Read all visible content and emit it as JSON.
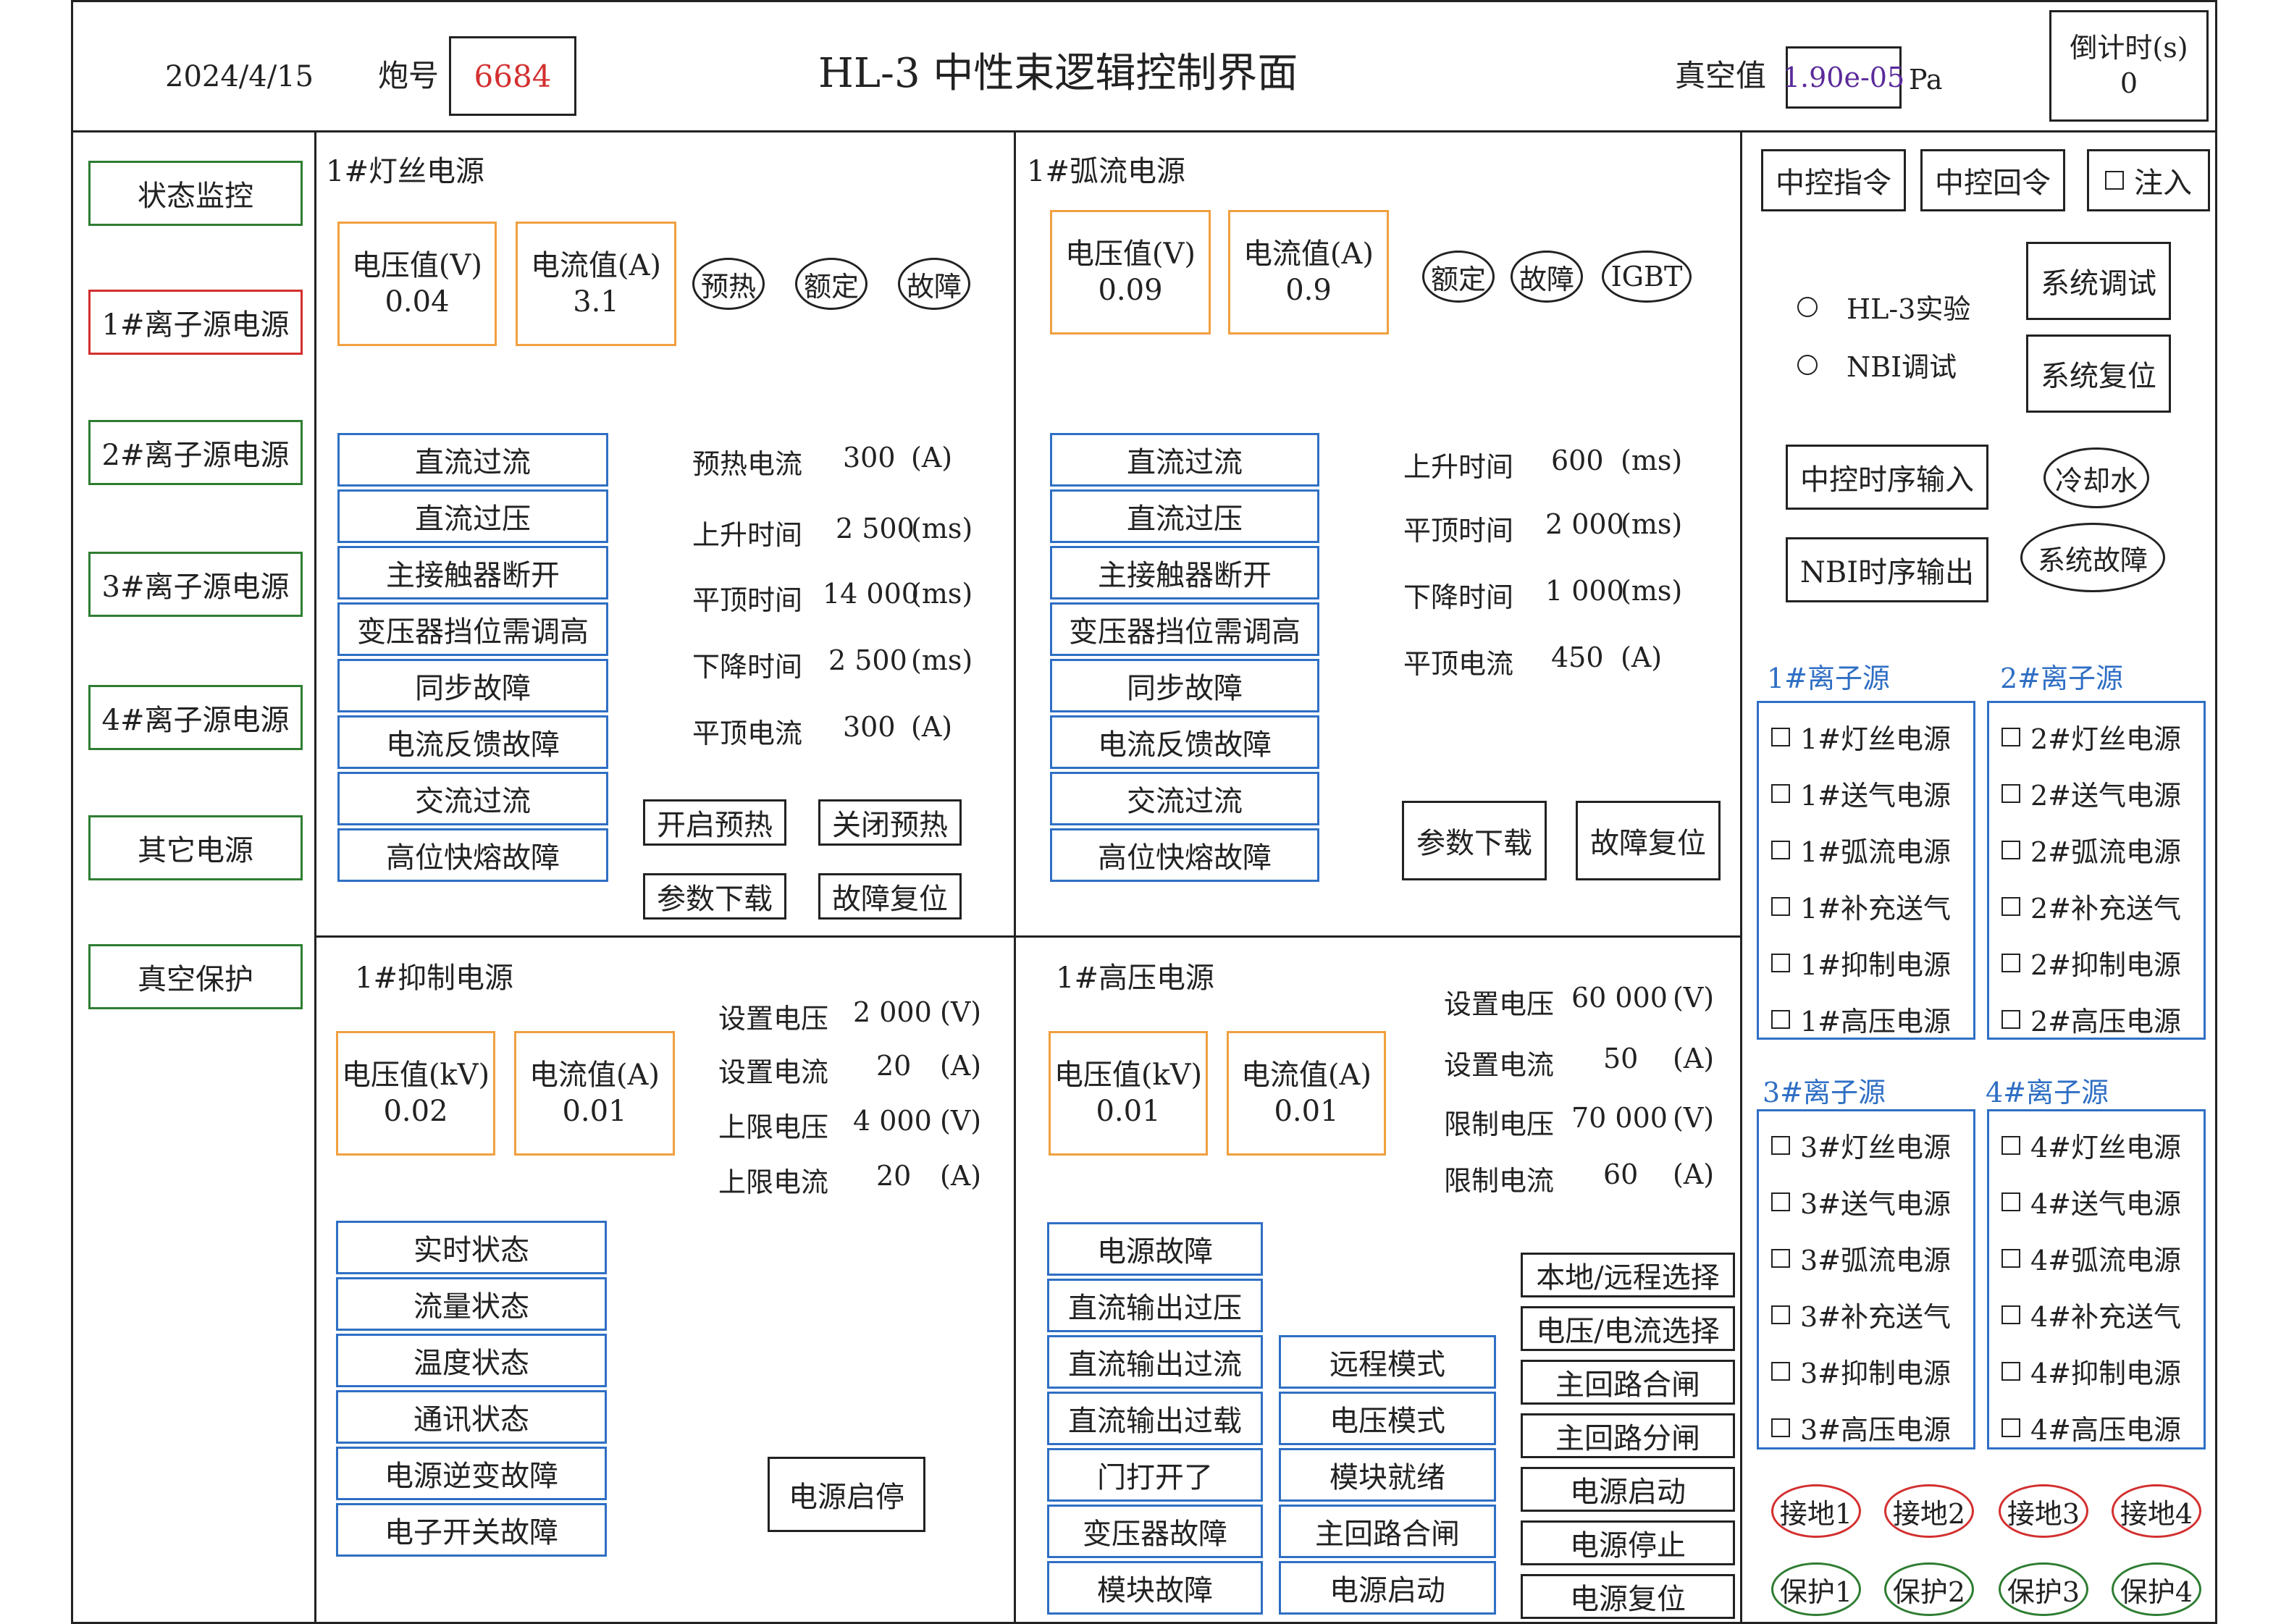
{
  "header": {
    "date": "2024/4/15",
    "shot_label": "炮号",
    "shot_number": "6684",
    "title": "HL-3 中性束逻辑控制界面",
    "vacuum_label": "真空值",
    "vacuum_value": "1.90e-05",
    "vacuum_unit": "Pa",
    "countdown_label": "倒计时(s)",
    "countdown_value": "0"
  },
  "sidebar": [
    {
      "label": "状态监控"
    },
    {
      "label": "1#离子源电源"
    },
    {
      "label": "2#离子源电源"
    },
    {
      "label": "3#离子源电源"
    },
    {
      "label": "4#离子源电源"
    },
    {
      "label": "其它电源"
    },
    {
      "label": "真空保护"
    }
  ],
  "filament": {
    "title": "1#灯丝电源",
    "voltage_label": "电压值(V)",
    "voltage_value": "0.04",
    "current_label": "电流值(A)",
    "current_value": "3.1",
    "indicators": [
      "预热",
      "额定",
      "故障"
    ],
    "faults": [
      "直流过流",
      "直流过压",
      "主接触器断开",
      "变压器挡位需调高",
      "同步故障",
      "电流反馈故障",
      "交流过流",
      "高位快熔故障"
    ],
    "params": [
      {
        "name": "预热电流",
        "value": "300",
        "unit": "(A)"
      },
      {
        "name": "上升时间",
        "value": "2 500",
        "unit": "(ms)"
      },
      {
        "name": "平顶时间",
        "value": "14 000",
        "unit": "(ms)"
      },
      {
        "name": "下降时间",
        "value": "2 500",
        "unit": "(ms)"
      },
      {
        "name": "平顶电流",
        "value": "300",
        "unit": "(A)"
      }
    ],
    "buttons": [
      "开启预热",
      "关闭预热",
      "参数下载",
      "故障复位"
    ]
  },
  "arc": {
    "title": "1#弧流电源",
    "voltage_label": "电压值(V)",
    "voltage_value": "0.09",
    "current_label": "电流值(A)",
    "current_value": "0.9",
    "indicators": [
      "额定",
      "故障",
      "IGBT"
    ],
    "faults": [
      "直流过流",
      "直流过压",
      "主接触器断开",
      "变压器挡位需调高",
      "同步故障",
      "电流反馈故障",
      "交流过流",
      "高位快熔故障"
    ],
    "params": [
      {
        "name": "上升时间",
        "value": "600",
        "unit": "(ms)"
      },
      {
        "name": "平顶时间",
        "value": "2 000",
        "unit": "(ms)"
      },
      {
        "name": "下降时间",
        "value": "1 000",
        "unit": "(ms)"
      },
      {
        "name": "平顶电流",
        "value": "450",
        "unit": "(A)"
      }
    ],
    "buttons": [
      "参数下载",
      "故障复位"
    ]
  },
  "suppress": {
    "title": "1#抑制电源",
    "voltage_label": "电压值(kV)",
    "voltage_value": "0.02",
    "current_label": "电流值(A)",
    "current_value": "0.01",
    "params": [
      {
        "name": "设置电压",
        "value": "2 000",
        "unit": "(V)"
      },
      {
        "name": "设置电流",
        "value": "20",
        "unit": "(A)"
      },
      {
        "name": "上限电压",
        "value": "4 000",
        "unit": "(V)"
      },
      {
        "name": "上限电流",
        "value": "20",
        "unit": "(A)"
      }
    ],
    "status": [
      "实时状态",
      "流量状态",
      "温度状态",
      "通讯状态",
      "电源逆变故障",
      "电子开关故障"
    ],
    "button": "电源启停"
  },
  "hv": {
    "title": "1#高压电源",
    "voltage_label": "电压值(kV)",
    "voltage_value": "0.01",
    "current_label": "电流值(A)",
    "current_value": "0.01",
    "params": [
      {
        "name": "设置电压",
        "value": "60 000",
        "unit": "(V)"
      },
      {
        "name": "设置电流",
        "value": "50",
        "unit": "(A)"
      },
      {
        "name": "限制电压",
        "value": "70 000",
        "unit": "(V)"
      },
      {
        "name": "限制电流",
        "value": "60",
        "unit": "(A)"
      }
    ],
    "faults": [
      "电源故障",
      "直流输出过压",
      "直流输出过流",
      "直流输出过载",
      "门打开了",
      "变压器故障",
      "模块故障"
    ],
    "modes": [
      "远程模式",
      "电压模式",
      "模块就绪",
      "主回路合闸",
      "电源启动"
    ],
    "controls": [
      "本地/远程选择",
      "电压/电流选择",
      "主回路合闸",
      "主回路分闸",
      "电源启动",
      "电源停止",
      "电源复位"
    ]
  },
  "right": {
    "cmd": "中控指令",
    "reply": "中控回令",
    "inject": "注入",
    "radios": [
      "HL-3实验",
      "NBI调试"
    ],
    "sys_debug": "系统调试",
    "sys_reset": "系统复位",
    "seq_in": "中控时序输入",
    "seq_out": "NBI时序输出",
    "cooling": "冷却水",
    "sys_fault": "系统故障",
    "groups": [
      {
        "title": "1#离子源",
        "items": [
          "1#灯丝电源",
          "1#送气电源",
          "1#弧流电源",
          "1#补充送气",
          "1#抑制电源",
          "1#高压电源"
        ]
      },
      {
        "title": "2#离子源",
        "items": [
          "2#灯丝电源",
          "2#送气电源",
          "2#弧流电源",
          "2#补充送气",
          "2#抑制电源",
          "2#高压电源"
        ]
      },
      {
        "title": "3#离子源",
        "items": [
          "3#灯丝电源",
          "3#送气电源",
          "3#弧流电源",
          "3#补充送气",
          "3#抑制电源",
          "3#高压电源"
        ]
      },
      {
        "title": "4#离子源",
        "items": [
          "4#灯丝电源",
          "4#送气电源",
          "4#弧流电源",
          "4#补充送气",
          "4#抑制电源",
          "4#高压电源"
        ]
      }
    ],
    "ground": [
      "接地1",
      "接地2",
      "接地3",
      "接地4"
    ],
    "protect": [
      "保护1",
      "保护2",
      "保护3",
      "保护4"
    ]
  },
  "colors": {
    "accent_red": "#d32f2f",
    "accent_green": "#2e7d32",
    "accent_blue": "#2f6fc4",
    "accent_orange": "#f0a040",
    "vacuum_purple": "#5b2a9a"
  }
}
